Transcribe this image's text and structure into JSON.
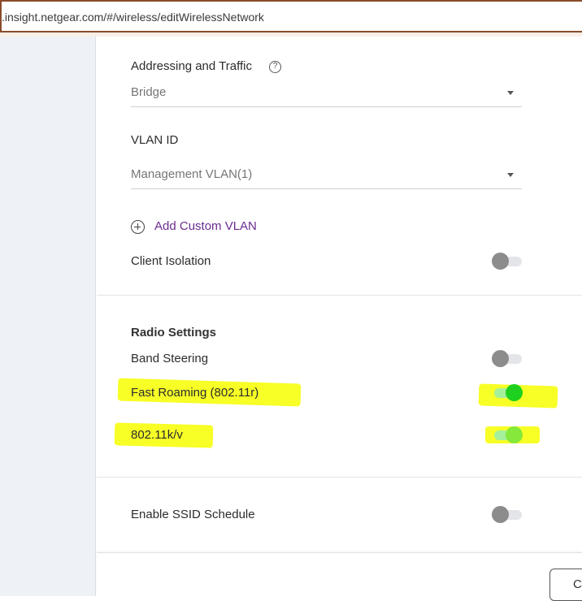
{
  "browser": {
    "url": ".insight.netgear.com/#/wireless/editWirelessNetwork"
  },
  "form": {
    "addressing": {
      "label": "Addressing and Traffic",
      "help_icon": "?",
      "value": "Bridge"
    },
    "vlan": {
      "label": "VLAN ID",
      "value": "Management VLAN(1)"
    },
    "add_custom_vlan": "Add Custom VLAN",
    "client_isolation": {
      "label": "Client Isolation",
      "enabled": false
    }
  },
  "radio_settings": {
    "heading": "Radio Settings",
    "band_steering": {
      "label": "Band Steering",
      "enabled": false
    },
    "fast_roaming": {
      "label": "Fast Roaming (802.11r)",
      "enabled": true
    },
    "kv": {
      "label": "802.11k/v",
      "enabled": true
    }
  },
  "ssid_schedule": {
    "label": "Enable SSID Schedule",
    "enabled": false
  },
  "footer": {
    "button_label": "C"
  },
  "colors": {
    "accent_link": "#6b2c8f",
    "toggle_on": "#1fd11f",
    "toggle_off": "#8c8c8c",
    "highlight": "#f6ff00"
  }
}
